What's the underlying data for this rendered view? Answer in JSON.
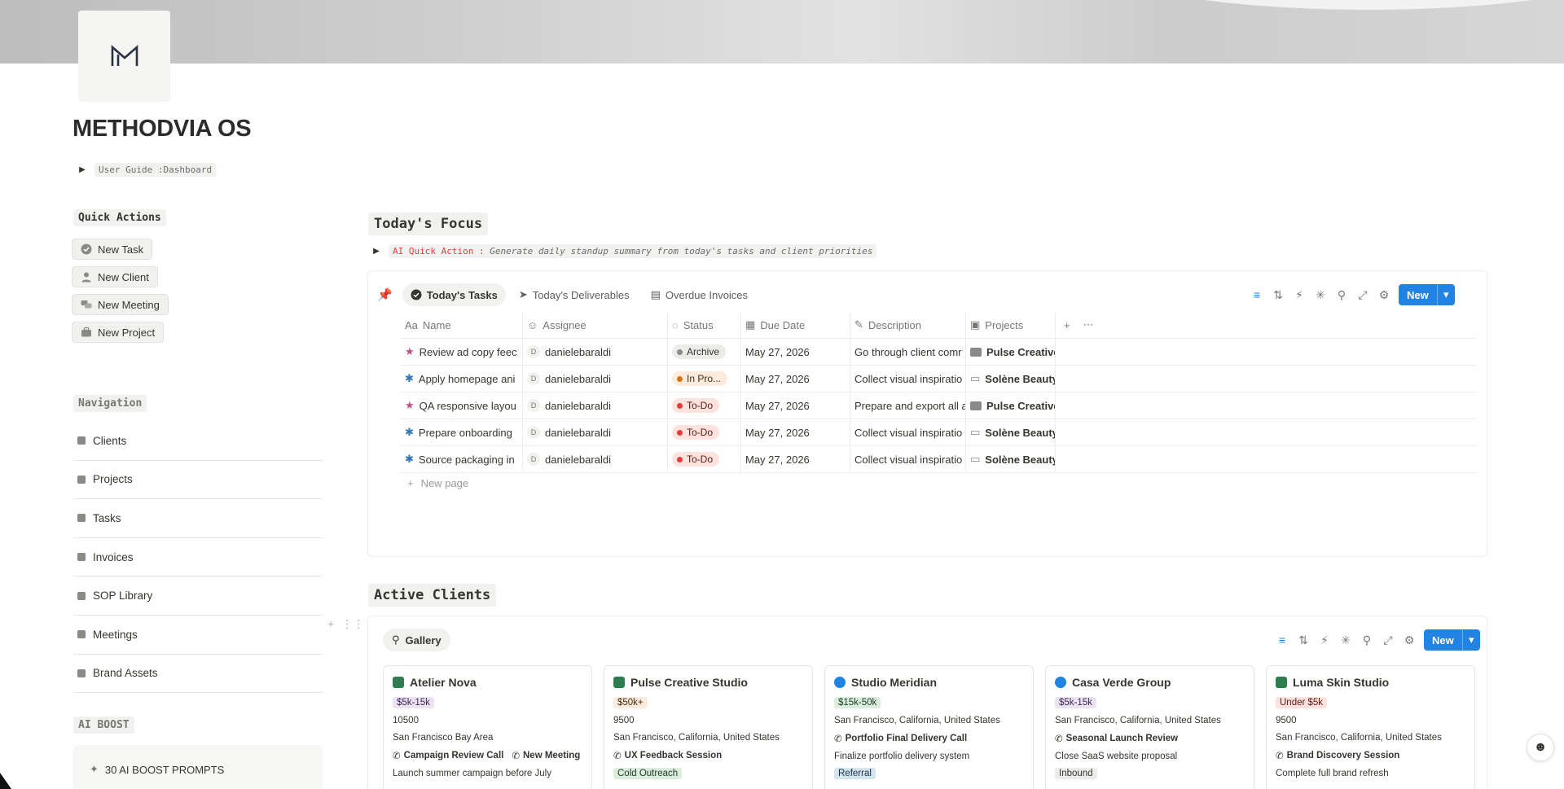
{
  "page": {
    "title": "METHODVIA OS",
    "user_guide_label": "User Guide :Dashboard"
  },
  "quick_actions": {
    "heading": "Quick Actions",
    "buttons": [
      {
        "label": "New Task",
        "icon": "check-circle-icon"
      },
      {
        "label": "New Client",
        "icon": "user-icon"
      },
      {
        "label": "New Meeting",
        "icon": "chat-bubbles-icon"
      },
      {
        "label": "New Project",
        "icon": "briefcase-icon"
      }
    ]
  },
  "navigation": {
    "heading": "Navigation",
    "items": [
      "Clients",
      "Projects",
      "Tasks",
      "Invoices",
      "SOP Library",
      "Meetings",
      "Brand Assets"
    ]
  },
  "ai_boost": {
    "heading": "AI BOOST",
    "prompt_label": "30 AI BOOST PROMPTS"
  },
  "todays_focus": {
    "heading": "Today's Focus",
    "ai_action_prefix": "AI Quick Action : ",
    "ai_action_text": "Generate daily standup summary from today's tasks and client priorities",
    "tabs": [
      "Today's Tasks",
      "Today's Deliverables",
      "Overdue Invoices"
    ],
    "new_label": "New",
    "columns": [
      "Name",
      "Assignee",
      "Status",
      "Due Date",
      "Description",
      "Projects"
    ],
    "rows": [
      {
        "name": "Review ad copy feec",
        "assignee": "danielebaraldi",
        "status": "Archive",
        "status_kind": "archive",
        "due": "May 27, 2026",
        "description": "Go through client comr",
        "project": "Pulse Creative",
        "icon": "star-icon"
      },
      {
        "name": "Apply homepage ani",
        "assignee": "danielebaraldi",
        "status": "In Pro...",
        "status_kind": "inprog",
        "due": "May 27, 2026",
        "description": "Collect visual inspiratio",
        "project": "Solène Beauty",
        "icon": "asterisk-icon"
      },
      {
        "name": "QA responsive layou",
        "assignee": "danielebaraldi",
        "status": "To-Do",
        "status_kind": "todo",
        "due": "May 27, 2026",
        "description": "Prepare and export all a",
        "project": "Pulse Creative",
        "icon": "star-icon"
      },
      {
        "name": "Prepare onboarding",
        "assignee": "danielebaraldi",
        "status": "To-Do",
        "status_kind": "todo",
        "due": "May 27, 2026",
        "description": "Collect visual inspiratio",
        "project": "Solène Beauty",
        "icon": "asterisk-icon"
      },
      {
        "name": "Source packaging in",
        "assignee": "danielebaraldi",
        "status": "To-Do",
        "status_kind": "todo",
        "due": "May 27, 2026",
        "description": "Collect visual inspiratio",
        "project": "Solène Beauty",
        "icon": "asterisk-icon"
      }
    ],
    "avatar_letter": "D",
    "new_page_label": "New page"
  },
  "active_clients": {
    "heading": "Active Clients",
    "view_label": "Gallery",
    "new_label": "New",
    "cards": [
      {
        "name": "Atelier Nova",
        "budget": "$5k-15k",
        "budget_kind": "purple",
        "value": "10500",
        "location": "San Francisco Bay Area",
        "meetings": [
          "Campaign Review Call",
          "New Meeting"
        ],
        "note": "Launch summer campaign before July",
        "note_kind": "",
        "icon_color": "#2e7d4f"
      },
      {
        "name": "Pulse Creative Studio",
        "budget": "$50k+",
        "budget_kind": "orange",
        "value": "9500",
        "location": "San Francisco, California, United States",
        "meetings": [
          "UX Feedback Session"
        ],
        "note": "Cold Outreach",
        "note_kind": "green",
        "icon_color": "#2e7d4f"
      },
      {
        "name": "Studio Meridian",
        "budget": "$15k-50k",
        "budget_kind": "green",
        "value": "",
        "location": "San Francisco, California, United States",
        "meetings": [
          "Portfolio Final Delivery Call"
        ],
        "note": "Finalize portfolio delivery system",
        "note_kind": "",
        "tag2": "Referral",
        "tag2_kind": "blue",
        "icon_color": "#2383e2"
      },
      {
        "name": "Casa Verde Group",
        "budget": "$5k-15k",
        "budget_kind": "purple",
        "value": "",
        "location": "San Francisco, California, United States",
        "meetings": [
          "Seasonal Launch Review"
        ],
        "note": "Close SaaS website proposal",
        "note_kind": "",
        "tag2": "Inbound",
        "tag2_kind": "gray",
        "icon_color": "#2383e2"
      },
      {
        "name": "Luma Skin Studio",
        "budget": "Under $5k",
        "budget_kind": "red",
        "value": "9500",
        "location": "San Francisco, California, United States",
        "meetings": [
          "Brand Discovery Session"
        ],
        "note": "Complete full brand refresh",
        "note_kind": "",
        "icon_color": "#2e7d4f"
      }
    ]
  }
}
